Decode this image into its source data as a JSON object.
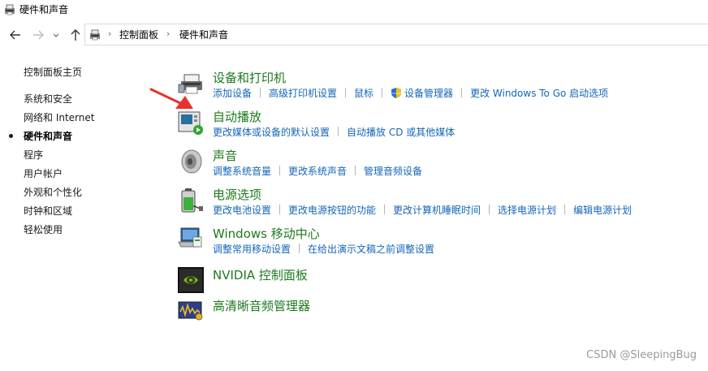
{
  "window": {
    "title": "硬件和声音"
  },
  "nav": {
    "back_icon": "back-arrow-icon",
    "forward_icon": "forward-arrow-icon",
    "recent_icon": "chevron-down-icon",
    "up_icon": "up-arrow-icon"
  },
  "address": {
    "crumbs": [
      "控制面板",
      "硬件和声音"
    ]
  },
  "sidebar": {
    "items": [
      {
        "label": "控制面板主页"
      },
      {
        "label": "系统和安全"
      },
      {
        "label": "网络和 Internet"
      },
      {
        "label": "硬件和声音",
        "active": true
      },
      {
        "label": "程序"
      },
      {
        "label": "用户帐户"
      },
      {
        "label": "外观和个性化"
      },
      {
        "label": "时钟和区域"
      },
      {
        "label": "轻松使用"
      }
    ]
  },
  "categories": [
    {
      "title": "设备和打印机",
      "icon": "printer-icon",
      "links": [
        "添加设备",
        "高级打印机设置",
        "鼠标",
        "设备管理器",
        "更改 Windows To Go 启动选项"
      ]
    },
    {
      "title": "自动播放",
      "icon": "autoplay-icon",
      "links": [
        "更改媒体或设备的默认设置",
        "自动播放 CD 或其他媒体"
      ]
    },
    {
      "title": "声音",
      "icon": "speaker-icon",
      "links": [
        "调整系统音量",
        "更改系统声音",
        "管理音频设备"
      ]
    },
    {
      "title": "电源选项",
      "icon": "battery-icon",
      "links": [
        "更改电池设置",
        "更改电源按钮的功能",
        "更改计算机睡眠时间",
        "选择电源计划",
        "编辑电源计划"
      ]
    },
    {
      "title": "Windows 移动中心",
      "icon": "mobility-center-icon",
      "links": [
        "调整常用移动设置",
        "在给出演示文稿之前调整设置"
      ]
    },
    {
      "title": "NVIDIA 控制面板",
      "icon": "nvidia-icon",
      "links": []
    },
    {
      "title": "高清晰音频管理器",
      "icon": "audio-manager-icon",
      "links": []
    }
  ],
  "watermark": "CSDN @SleepingBug",
  "colors": {
    "category_title": "#1e7a1e",
    "link": "#1466b8",
    "annotation_arrow": "#e8322b"
  }
}
